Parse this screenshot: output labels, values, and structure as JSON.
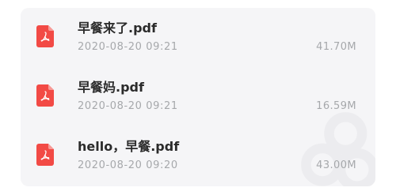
{
  "files": [
    {
      "name": "早餐来了.pdf",
      "date": "2020-08-20 09:21",
      "size": "41.70M",
      "icon": "pdf-file-icon"
    },
    {
      "name": "早餐妈.pdf",
      "date": "2020-08-20 09:21",
      "size": "16.59M",
      "icon": "pdf-file-icon"
    },
    {
      "name": "hello，早餐.pdf",
      "date": "2020-08-20 09:20",
      "size": "43.00M",
      "icon": "pdf-file-icon"
    }
  ],
  "colors": {
    "pdf_icon": "#f24a45",
    "card_background": "#f5f5f7",
    "name_text": "#2b2b2b",
    "meta_text": "#a6a8ab"
  }
}
